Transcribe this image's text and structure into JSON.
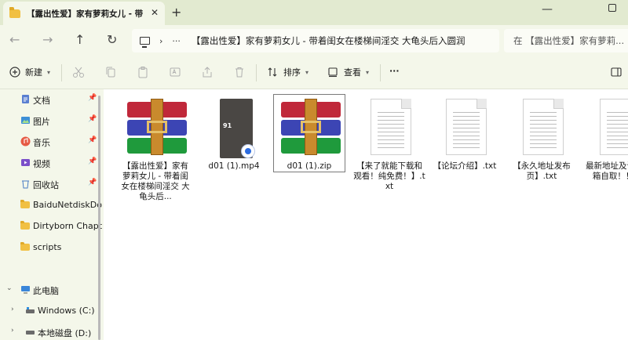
{
  "tab": {
    "title": "【露出性爱】家有萝莉女儿 - 带",
    "close": "✕"
  },
  "window": {
    "new_tab": "+",
    "minimize": "—"
  },
  "nav": {
    "back": "←",
    "forward": "→",
    "up": "↑",
    "refresh": "↻"
  },
  "address": {
    "separator": "›",
    "more": "···",
    "path": "【露出性爱】家有萝莉女儿 - 带着闺女在楼梯间淫交 大龟头后入圆润"
  },
  "search": {
    "placeholder": "在 【露出性爱】家有萝莉..."
  },
  "toolbar": {
    "new_label": "新建",
    "sort_label": "排序",
    "view_label": "查看",
    "more_label": "···"
  },
  "sidebar": {
    "quick": [
      {
        "label": "文档",
        "icon": "document-icon"
      },
      {
        "label": "图片",
        "icon": "pictures-icon"
      },
      {
        "label": "音乐",
        "icon": "music-icon"
      },
      {
        "label": "视频",
        "icon": "video-icon"
      },
      {
        "label": "回收站",
        "icon": "recycle-bin-icon"
      }
    ],
    "folders": [
      "BaiduNetdiskDo",
      "Dirtyborn Chapt",
      "scripts"
    ],
    "this_pc": "此电脑",
    "drives": [
      "Windows (C:)",
      "本地磁盘 (D:)"
    ]
  },
  "files": [
    {
      "name": "【露出性爱】家有萝莉女儿 - 带着闺女在楼梯间淫交 大龟头后...",
      "type": "rar"
    },
    {
      "name": "d01 (1).mp4",
      "type": "mp4"
    },
    {
      "name": "d01 (1).zip",
      "type": "rar",
      "selected": true
    },
    {
      "name": "【来了就能下载和观看！纯免费！】.txt",
      "type": "txt"
    },
    {
      "name": "【论坛介绍】.txt",
      "type": "txt"
    },
    {
      "name": "【永久地址发布页】.txt",
      "type": "txt"
    },
    {
      "name": "最新地址及请发邮箱自取！！！.",
      "type": "txt"
    }
  ],
  "colors": {
    "accent": "#2b6be0",
    "folder": "#f1c043"
  }
}
